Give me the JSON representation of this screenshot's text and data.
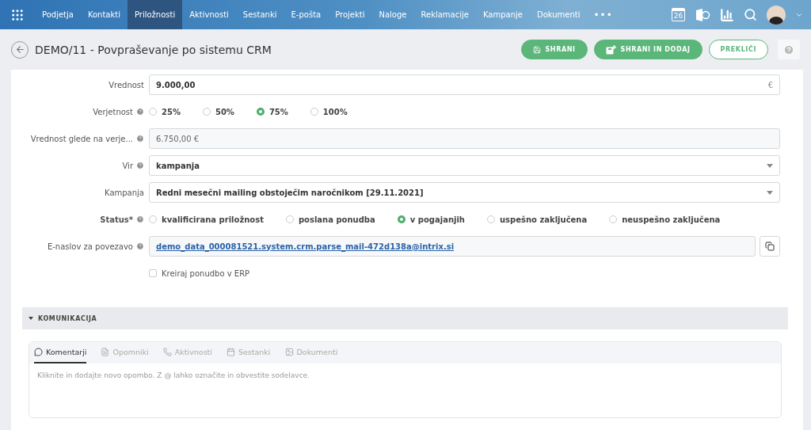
{
  "nav": {
    "items": [
      {
        "label": "Podjetja",
        "selected": false
      },
      {
        "label": "Kontakti",
        "selected": false
      },
      {
        "label": "Priložnosti",
        "selected": true
      },
      {
        "label": "Aktivnosti",
        "selected": false
      },
      {
        "label": "Sestanki",
        "selected": false
      },
      {
        "label": "E-pošta",
        "selected": false
      },
      {
        "label": "Projekti",
        "selected": false
      },
      {
        "label": "Naloge",
        "selected": false
      },
      {
        "label": "Reklamacije",
        "selected": false
      },
      {
        "label": "Kampanje",
        "selected": false
      },
      {
        "label": "Dokumenti",
        "selected": false
      }
    ],
    "more": "•••",
    "calendar_day": "26"
  },
  "header": {
    "title": "DEMO/11 - Povpraševanje po sistemu CRM",
    "buttons": [
      {
        "label": "SHRANI",
        "kind": "save"
      },
      {
        "label": "SHRANI IN DODAJ",
        "kind": "save_add"
      },
      {
        "label": "PREKLIČI",
        "kind": "cancel"
      }
    ]
  },
  "form": [
    {
      "kind": "input",
      "label": "Vrednost",
      "help": false,
      "required": false,
      "value": "9.000,00",
      "suffix": "€"
    },
    {
      "kind": "radio",
      "label": "Verjetnost",
      "help": true,
      "required": false,
      "options": [
        {
          "label": "25%",
          "selected": false
        },
        {
          "label": "50%",
          "selected": false
        },
        {
          "label": "75%",
          "selected": true
        },
        {
          "label": "100%",
          "selected": false
        }
      ]
    },
    {
      "kind": "readonly",
      "label": "Vrednost glede na verje...",
      "help": true,
      "required": false,
      "value": "6.750,00 €"
    },
    {
      "kind": "select",
      "label": "Vir",
      "help": true,
      "required": false,
      "value": "kampanja"
    },
    {
      "kind": "select",
      "label": "Kampanja",
      "help": false,
      "required": false,
      "value": "Redni mesečni mailing obstoječim naročnikom [29.11.2021]"
    },
    {
      "kind": "radio",
      "label": "Status*",
      "help": true,
      "required": true,
      "options": [
        {
          "label": "kvalificirana priložnost",
          "selected": false
        },
        {
          "label": "poslana ponudba",
          "selected": false
        },
        {
          "label": "v pogajanjih",
          "selected": true
        },
        {
          "label": "uspešno zaključena",
          "selected": false
        },
        {
          "label": "neuspešno zaključena",
          "selected": false
        }
      ]
    },
    {
      "kind": "link",
      "label": "E-naslov za povezavo",
      "help": true,
      "required": false,
      "value": "demo_data_000081521.system.crm.parse_mail-472d138a@intrix.si"
    },
    {
      "kind": "checkbox",
      "label": "Kreiraj ponudbo v ERP",
      "checked": false
    }
  ],
  "section": {
    "title": "KOMUNIKACIJA",
    "expanded": true,
    "tabs": [
      {
        "label": "Komentarji",
        "selected": true
      },
      {
        "label": "Opomniki",
        "selected": false
      },
      {
        "label": "Aktivnosti",
        "selected": false
      },
      {
        "label": "Sestanki",
        "selected": false
      },
      {
        "label": "Dokumenti",
        "selected": false
      }
    ],
    "placeholder": "Kliknite in dodajte novo opombo. Z @ lahko označite in obvestite sodelavce."
  }
}
